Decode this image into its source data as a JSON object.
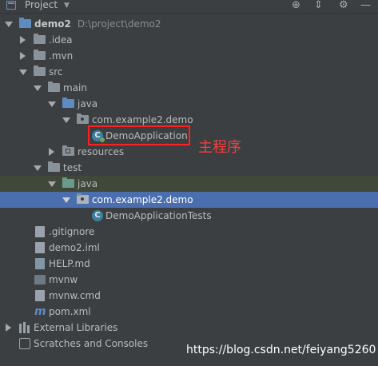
{
  "panel": {
    "title": "Project",
    "title_icon": "project-panel-icon",
    "actions": [
      "locate-icon",
      "collapse-icon",
      "settings-icon",
      "hide-icon"
    ]
  },
  "tree": {
    "root": {
      "name": "demo2",
      "path": "D:\\project\\demo2"
    },
    "idea": ".idea",
    "mvn": ".mvn",
    "src": "src",
    "main": "main",
    "main_java": "java",
    "main_package": "com.example2.demo",
    "demo_application": "DemoApplication",
    "resources": "resources",
    "test": "test",
    "test_java": "java",
    "test_package": "com.example2.demo",
    "demo_application_tests": "DemoApplicationTests",
    "gitignore": ".gitignore",
    "iml": "demo2.iml",
    "help": "HELP.md",
    "mvnw": "mvnw",
    "mvnw_cmd": "mvnw.cmd",
    "pom": "pom.xml",
    "external_libraries": "External Libraries",
    "scratches": "Scratches and Consoles"
  },
  "annotation": {
    "text": "主程序",
    "color": "#ff3b3b"
  },
  "watermark": "https://blog.csdn.net/feiyang5260",
  "colors": {
    "background": "#3c3f41",
    "selection": "#4b6eaf",
    "test_highlight": "#40483a"
  }
}
